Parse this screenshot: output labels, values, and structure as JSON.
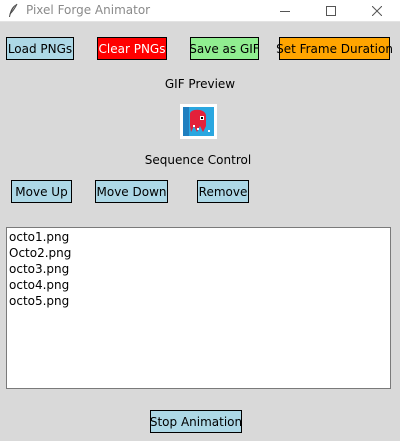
{
  "window": {
    "title": "Pixel Forge Animator"
  },
  "toolbar": {
    "load_label": "Load PNGs",
    "clear_label": "Clear PNGs",
    "save_label": "Save as GIF",
    "duration_label": "Set Frame Duration"
  },
  "preview": {
    "label": "GIF Preview"
  },
  "sequence": {
    "label": "Sequence Control",
    "move_up_label": "Move Up",
    "move_down_label": "Move Down",
    "remove_label": "Remove"
  },
  "files": [
    "octo1.png",
    "Octo2.png",
    "octo3.png",
    "octo4.png",
    "octo5.png"
  ],
  "animation": {
    "stop_label": "Stop Animation"
  },
  "colors": {
    "button_blue": "#add8e6",
    "button_red": "#ff0000",
    "button_green": "#90ee90",
    "button_orange": "#ffa500",
    "background": "#d9d9d9"
  }
}
